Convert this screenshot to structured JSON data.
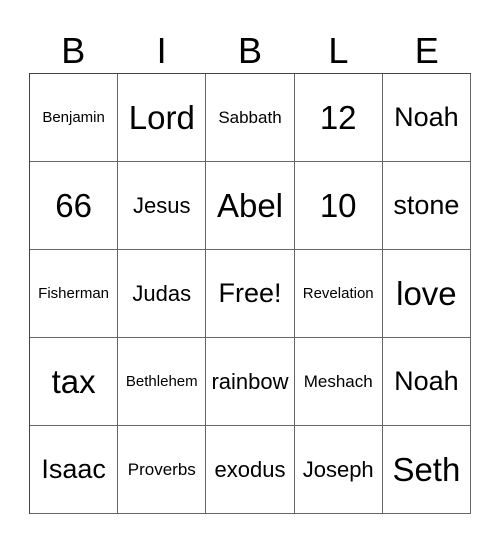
{
  "card": {
    "header": [
      "B",
      "I",
      "B",
      "L",
      "E"
    ],
    "rows": [
      [
        "Benjamin",
        "Lord",
        "Sabbath",
        "12",
        "Noah"
      ],
      [
        "66",
        "Jesus",
        "Abel",
        "10",
        "stone"
      ],
      [
        "Fisherman",
        "Judas",
        "Free!",
        "Revelation",
        "love"
      ],
      [
        "tax",
        "Bethlehem",
        "rainbow",
        "Meshach",
        "Noah"
      ],
      [
        "Isaac",
        "Proverbs",
        "exodus",
        "Joseph",
        "Seth"
      ]
    ]
  }
}
